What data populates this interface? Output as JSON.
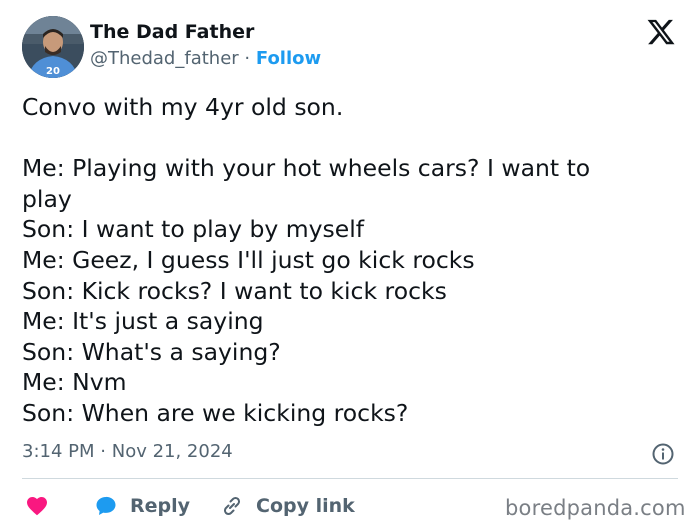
{
  "author": {
    "name": "The Dad Father",
    "handle": "@Thedad_father",
    "separator": "·",
    "follow_label": "Follow"
  },
  "tweet": {
    "lines": [
      "Convo with my 4yr old son.",
      "",
      "Me: Playing with your hot wheels cars? I want to",
      "play",
      "Son: I want to play by myself",
      "Me: Geez, I guess I'll just go kick rocks",
      "Son: Kick rocks? I want to kick rocks",
      "Me: It's just a saying",
      "Son: What's a saying?",
      "Me: Nvm",
      "Son: When are we kicking rocks?"
    ]
  },
  "meta": {
    "time": "3:14 PM",
    "separator": "·",
    "date": "Nov 21, 2024"
  },
  "actions": {
    "reply_label": "Reply",
    "copy_link_label": "Copy link"
  },
  "watermark": "boredpanda.com",
  "colors": {
    "accent": "#1d9bf0",
    "like": "#f91880",
    "text": "#0f1419",
    "muted": "#536471"
  },
  "icons": [
    "x-logo-icon",
    "heart-icon",
    "reply-bubble-icon",
    "link-icon",
    "info-icon"
  ]
}
